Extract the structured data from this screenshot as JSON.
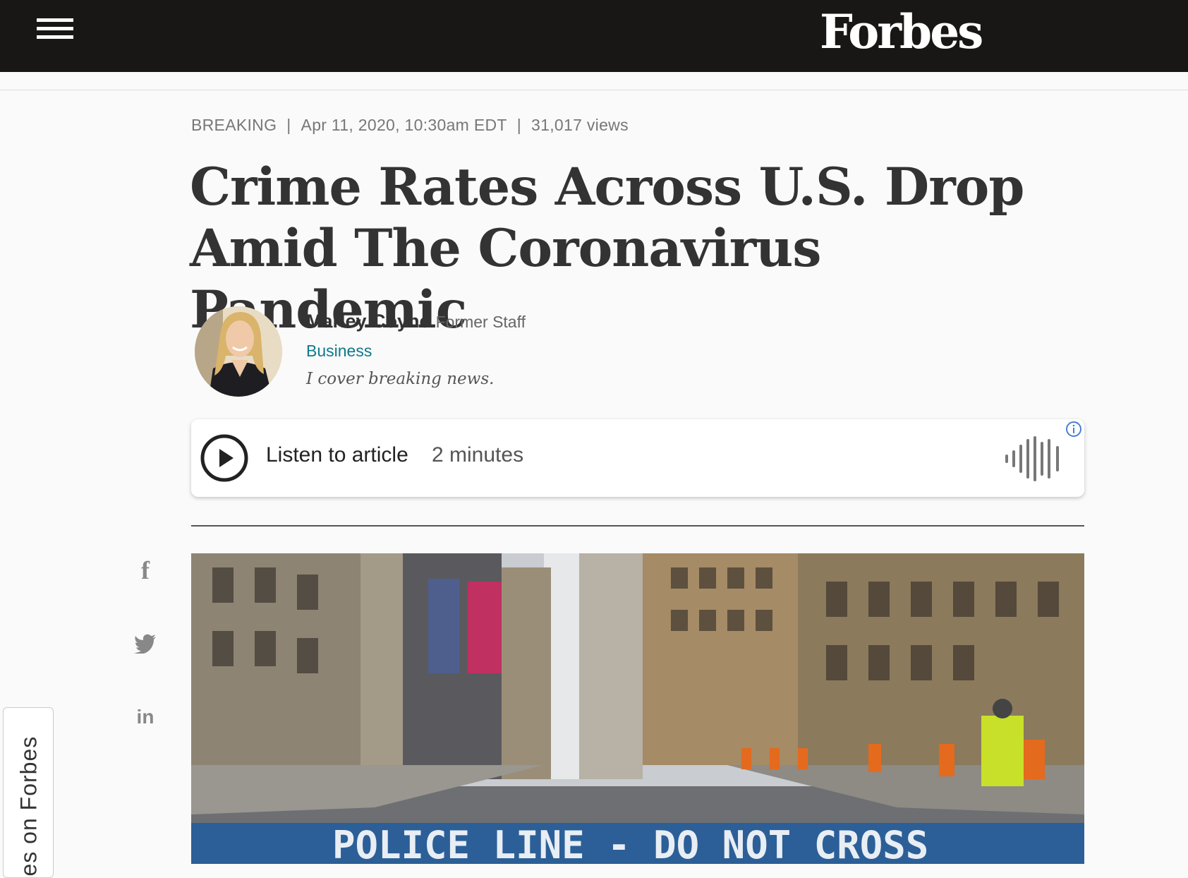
{
  "header": {
    "logo": "Forbes",
    "menu_icon": "hamburger-menu-icon"
  },
  "article": {
    "category": "BREAKING",
    "date": "Apr 11, 2020, 10:30am EDT",
    "views": "31,017 views",
    "separator": "|",
    "headline": "Crime Rates Across U.S. Drop Amid The Coronavirus Pandemic"
  },
  "author": {
    "name": "Marley Coyne",
    "role": "Former Staff",
    "channel": "Business",
    "bio": "I cover breaking news."
  },
  "audio_player": {
    "label": "Listen to article",
    "duration": "2 minutes",
    "play_icon": "play-icon",
    "wave_icon": "audio-wave-icon",
    "info_icon": "info-icon"
  },
  "social": {
    "facebook_glyph": "f",
    "twitter_icon": "twitter-icon",
    "linkedin_glyph": "in"
  },
  "side_tab": {
    "label": "es on Forbes"
  },
  "photo": {
    "banner_text": "POLICE  LINE  -  DO NOT CROSS"
  },
  "colors": {
    "topbar": "#181716",
    "channel_link": "#0d7a8a",
    "police_tape": "#2c5f97"
  }
}
